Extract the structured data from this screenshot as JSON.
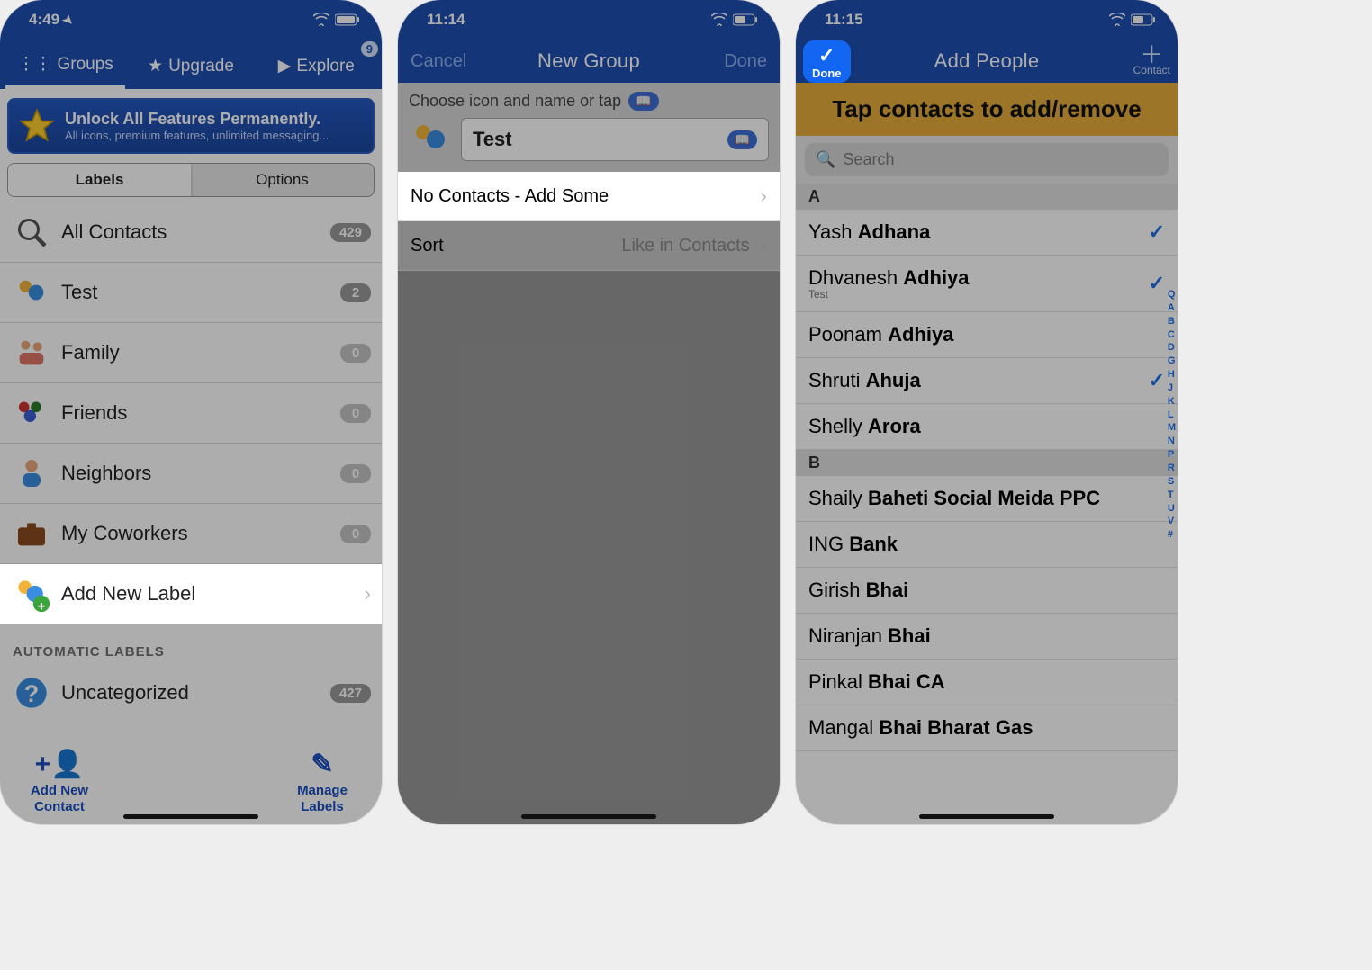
{
  "screen1": {
    "status": {
      "time": "4:49",
      "location_arrow": true
    },
    "tabs": {
      "groups": "Groups",
      "upgrade": "Upgrade",
      "explore": "Explore",
      "explore_badge": "9"
    },
    "unlock": {
      "title": "Unlock All Features Permanently.",
      "subtitle": "All icons, premium features, unlimited messaging..."
    },
    "seg": {
      "labels": "Labels",
      "options": "Options"
    },
    "rows": [
      {
        "label": "All Contacts",
        "count": "429"
      },
      {
        "label": "Test",
        "count": "2"
      },
      {
        "label": "Family",
        "count": "0"
      },
      {
        "label": "Friends",
        "count": "0"
      },
      {
        "label": "Neighbors",
        "count": "0"
      },
      {
        "label": "My Coworkers",
        "count": "0"
      }
    ],
    "add_new_label": "Add New Label",
    "auto_section": "AUTOMATIC LABELS",
    "uncategorized": {
      "label": "Uncategorized",
      "count": "427"
    },
    "bottom": {
      "add_contact": "Add New Contact",
      "manage_labels": "Manage Labels"
    }
  },
  "screen2": {
    "status": {
      "time": "11:14"
    },
    "nav": {
      "cancel": "Cancel",
      "title": "New Group",
      "done": "Done"
    },
    "hint": "Choose icon and name or tap",
    "group_name": "Test",
    "addrow": "No Contacts - Add Some",
    "sort": {
      "label": "Sort",
      "value": "Like in Contacts"
    }
  },
  "screen3": {
    "status": {
      "time": "11:15"
    },
    "nav": {
      "done": "Done",
      "title": "Add People",
      "contact": "Contact"
    },
    "banner": "Tap contacts to add/remove",
    "search_placeholder": "Search",
    "sections": {
      "A": [
        {
          "first": "Yash",
          "last": "Adhana",
          "checked": true
        },
        {
          "first": "Dhvanesh",
          "last": "Adhiya",
          "sub": "Test",
          "checked": true
        },
        {
          "first": "Poonam",
          "last": "Adhiya"
        },
        {
          "first": "Shruti",
          "last": "Ahuja",
          "checked": true
        },
        {
          "first": "Shelly",
          "last": "Arora"
        }
      ],
      "B": [
        {
          "first": "Shaily",
          "last": "Baheti Social Meida PPC"
        },
        {
          "first": "ING",
          "last": "Bank"
        },
        {
          "first": "Girish",
          "last": "Bhai"
        },
        {
          "first": "Niranjan",
          "last": "Bhai"
        },
        {
          "first": "Pinkal",
          "last": "Bhai CA"
        },
        {
          "first": "Mangal",
          "last": "Bhai Bharat Gas"
        }
      ]
    },
    "index_rail": [
      "Q",
      "A",
      "B",
      "C",
      "D",
      "G",
      "H",
      "J",
      "K",
      "L",
      "M",
      "N",
      "P",
      "R",
      "S",
      "T",
      "U",
      "V",
      "#"
    ]
  }
}
